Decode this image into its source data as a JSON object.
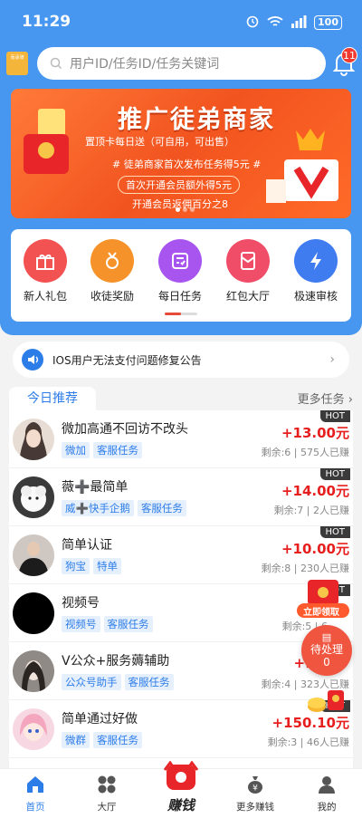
{
  "status": {
    "time": "11:29",
    "battery": "100"
  },
  "header": {
    "logo_text": "而承骑",
    "search_placeholder": "用户ID/任务ID/任务关键词",
    "msg_badge": "11"
  },
  "banner": {
    "title": "推广徒弟商家",
    "line1": "置顶卡每日送（可自用，可出售）",
    "line2": "# 徒弟商家首次发布任务得5元 #",
    "line3": "首次开通会员额外得5元",
    "line4": "开通会员返佣百分之8"
  },
  "menu": [
    {
      "label": "新人礼包",
      "icon": "gift-icon",
      "color": "#f25252"
    },
    {
      "label": "收徒奖励",
      "icon": "medal-icon",
      "color": "#f5932a"
    },
    {
      "label": "每日任务",
      "icon": "checklist-icon",
      "color": "#a855f0"
    },
    {
      "label": "红包大厅",
      "icon": "red-envelope-icon",
      "color": "#f04d68"
    },
    {
      "label": "极速审核",
      "icon": "lightning-icon",
      "color": "#3f7cf0"
    }
  ],
  "notice": {
    "text": "IOS用户无法支付问题修复公告"
  },
  "section": {
    "today": "今日推荐",
    "more": "更多任务"
  },
  "tasks": [
    {
      "title": "微加高通不回访不改头",
      "tags": [
        "微加",
        "客服任务"
      ],
      "price": "+13.00元",
      "remain": "剩余:6 | 575人已赚",
      "hot": "HOT"
    },
    {
      "title": "薇➕最简单",
      "tags": [
        "威➕快手企鹅",
        "客服任务"
      ],
      "price": "+14.00元",
      "remain": "剩余:7 | 2人已赚",
      "hot": "HOT"
    },
    {
      "title": "简单认证",
      "tags": [
        "狗宝",
        "特单"
      ],
      "price": "+10.00元",
      "remain": "剩余:8 | 230人已赚",
      "hot": "HOT"
    },
    {
      "title": "视频号",
      "tags": [
        "视频号",
        "客服任务"
      ],
      "price": "",
      "remain": "剩余:5 | 6",
      "hot": "HOT"
    },
    {
      "title": "V公众+服务薅辅助",
      "tags": [
        "公众号助手",
        "客服任务"
      ],
      "price": "+12",
      "remain": "剩余:4 | 323人已赚",
      "hot": ""
    },
    {
      "title": "简单通过好做",
      "tags": [
        "微群",
        "客服任务"
      ],
      "price": "+150.10元",
      "remain": "剩余:3 | 46人已赚",
      "hot": "HOT"
    }
  ],
  "floats": {
    "claim": "立即领取",
    "pending": "待处理",
    "pending_count": "0"
  },
  "tabbar": {
    "home": "首页",
    "hall": "大厅",
    "earn": "赚钱",
    "more": "更多赚钱",
    "mine": "我的"
  },
  "colors": {
    "primary": "#4796f0",
    "price": "#e61e1e"
  }
}
